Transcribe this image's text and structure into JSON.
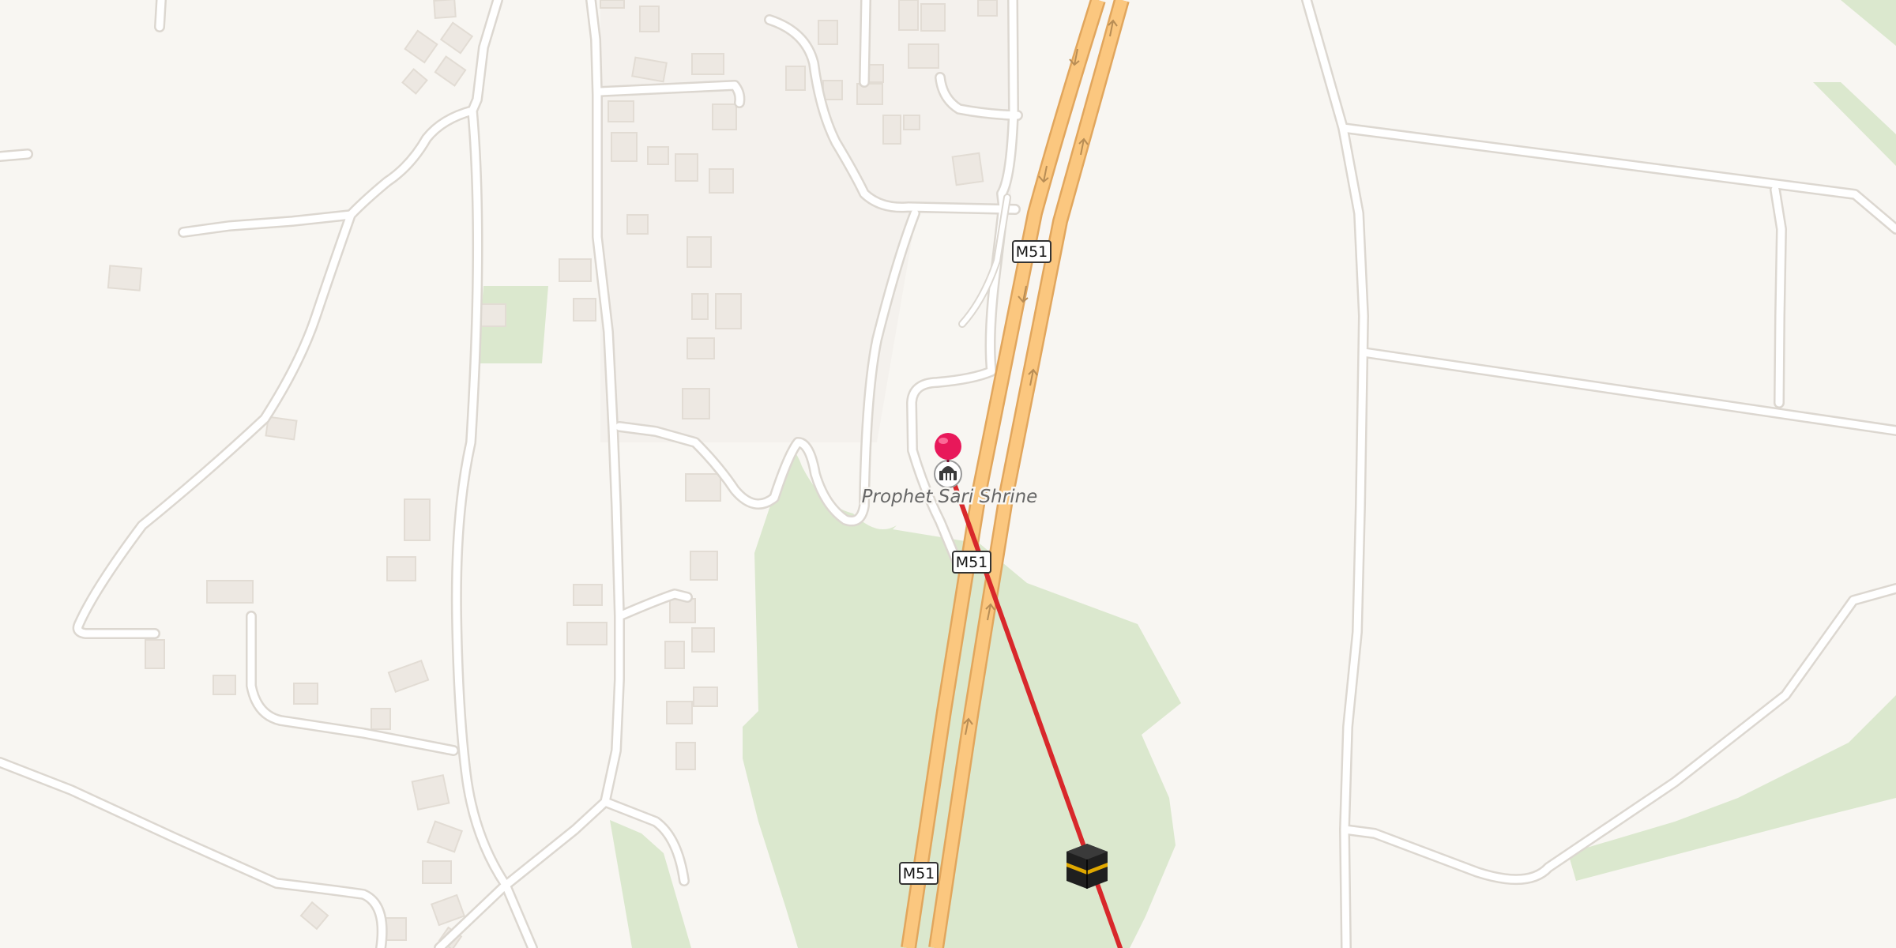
{
  "map": {
    "road_shields": [
      "M51",
      "M51",
      "M51"
    ],
    "poi": {
      "name": "Prophet Sari Shrine",
      "icon": "shrine-icon"
    },
    "marker_icon": "location-pin-icon",
    "destination_icon": "kaaba-icon",
    "route_line_icon": "qibla-direction-line"
  },
  "colors": {
    "background": "#f8f6f2",
    "park": "#dbe8ce",
    "motorway": "#fbc77f",
    "motorway_casing": "#e1a65d",
    "route_line": "#d8282b",
    "pin": "#e8185a",
    "building": "#ede8e2"
  }
}
